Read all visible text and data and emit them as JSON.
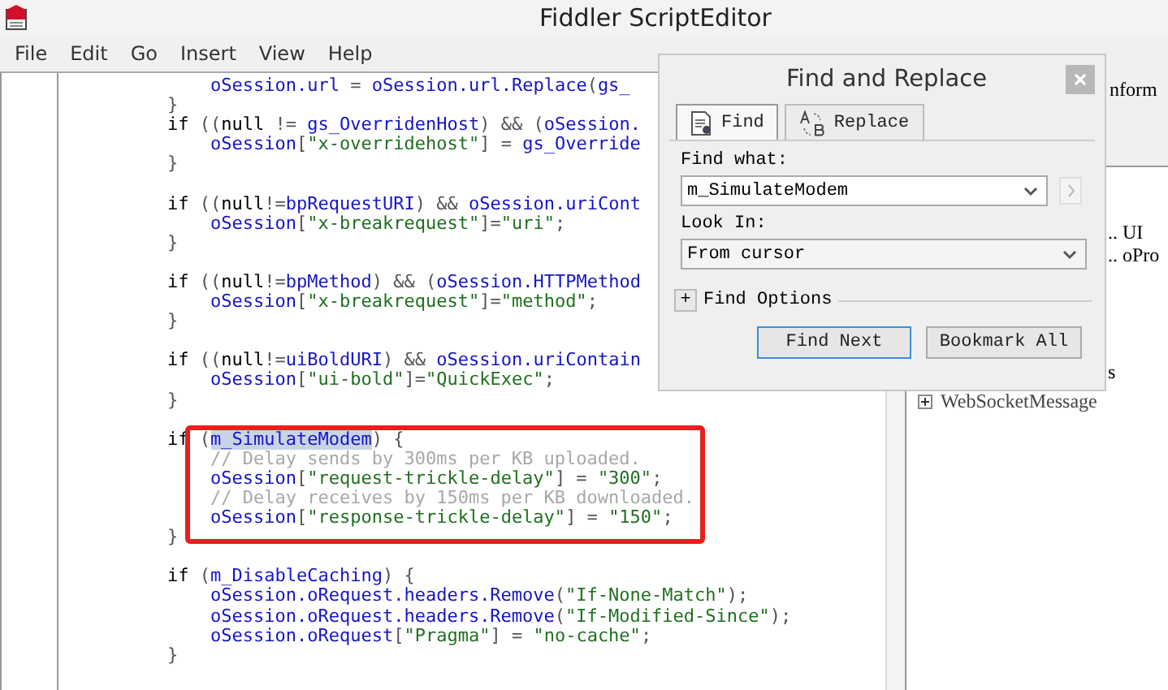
{
  "window": {
    "title": "Fiddler ScriptEditor"
  },
  "menu": [
    {
      "label": "File"
    },
    {
      "label": "Edit"
    },
    {
      "label": "Go"
    },
    {
      "label": "Insert"
    },
    {
      "label": "View"
    },
    {
      "label": "Help"
    }
  ],
  "editor": {
    "lines": [
      {
        "kind": "group",
        "children": [
          {
            "kind": "code",
            "tokens": [
              {
                "text": "oSession.url",
                "kind": "identifier"
              },
              {
                "text": " = ",
                "kind": "punct"
              },
              {
                "text": "oSession.url.Replace",
                "kind": "identifier"
              },
              {
                "text": "(",
                "kind": "punct"
              },
              {
                "text": "gs_",
                "kind": "identifier"
              }
            ]
          }
        ]
      },
      {
        "kind": "code",
        "tokens": [
          {
            "text": "}",
            "kind": "punct"
          }
        ]
      },
      {
        "kind": "code",
        "tokens": [
          {
            "text": "if",
            "kind": "keyword"
          },
          {
            "text": " ((",
            "kind": "punct"
          },
          {
            "text": "null",
            "kind": "keyword"
          },
          {
            "text": " != ",
            "kind": "punct"
          },
          {
            "text": "gs_OverridenHost",
            "kind": "identifier"
          },
          {
            "text": ") && (",
            "kind": "punct"
          },
          {
            "text": "oSession.",
            "kind": "identifier"
          }
        ],
        "children": [
          {
            "kind": "code",
            "tokens": [
              {
                "text": "oSession",
                "kind": "identifier"
              },
              {
                "text": "[",
                "kind": "punct"
              },
              {
                "text": "\"x-overridehost\"",
                "kind": "string"
              },
              {
                "text": "] = ",
                "kind": "punct"
              },
              {
                "text": "gs_Override",
                "kind": "identifier"
              }
            ]
          }
        ]
      },
      {
        "kind": "code",
        "tokens": [
          {
            "text": "}",
            "kind": "punct"
          }
        ]
      },
      {
        "kind": "blank"
      },
      {
        "kind": "code",
        "tokens": [
          {
            "text": "if",
            "kind": "keyword"
          },
          {
            "text": " ((",
            "kind": "punct"
          },
          {
            "text": "null",
            "kind": "keyword"
          },
          {
            "text": "!=",
            "kind": "punct"
          },
          {
            "text": "bpRequestURI",
            "kind": "identifier"
          },
          {
            "text": ") && ",
            "kind": "punct"
          },
          {
            "text": "oSession.uriCont",
            "kind": "identifier"
          }
        ],
        "children": [
          {
            "kind": "code",
            "tokens": [
              {
                "text": "oSession",
                "kind": "identifier"
              },
              {
                "text": "[",
                "kind": "punct"
              },
              {
                "text": "\"x-breakrequest\"",
                "kind": "string"
              },
              {
                "text": "]=",
                "kind": "punct"
              },
              {
                "text": "\"uri\"",
                "kind": "string"
              },
              {
                "text": ";",
                "kind": "punct"
              }
            ]
          }
        ]
      },
      {
        "kind": "code",
        "tokens": [
          {
            "text": "}",
            "kind": "punct"
          }
        ]
      },
      {
        "kind": "blank"
      },
      {
        "kind": "code",
        "tokens": [
          {
            "text": "if",
            "kind": "keyword"
          },
          {
            "text": " ((",
            "kind": "punct"
          },
          {
            "text": "null",
            "kind": "keyword"
          },
          {
            "text": "!=",
            "kind": "punct"
          },
          {
            "text": "bpMethod",
            "kind": "identifier"
          },
          {
            "text": ") && (",
            "kind": "punct"
          },
          {
            "text": "oSession.HTTPMethod",
            "kind": "identifier"
          }
        ],
        "children": [
          {
            "kind": "code",
            "tokens": [
              {
                "text": "oSession",
                "kind": "identifier"
              },
              {
                "text": "[",
                "kind": "punct"
              },
              {
                "text": "\"x-breakrequest\"",
                "kind": "string"
              },
              {
                "text": "]=",
                "kind": "punct"
              },
              {
                "text": "\"method\"",
                "kind": "string"
              },
              {
                "text": ";",
                "kind": "punct"
              }
            ]
          }
        ]
      },
      {
        "kind": "code",
        "tokens": [
          {
            "text": "}",
            "kind": "punct"
          }
        ]
      },
      {
        "kind": "blank"
      },
      {
        "kind": "code",
        "tokens": [
          {
            "text": "if",
            "kind": "keyword"
          },
          {
            "text": " ((",
            "kind": "punct"
          },
          {
            "text": "null",
            "kind": "keyword"
          },
          {
            "text": "!=",
            "kind": "punct"
          },
          {
            "text": "uiBoldURI",
            "kind": "identifier"
          },
          {
            "text": ") && ",
            "kind": "punct"
          },
          {
            "text": "oSession.uriContain",
            "kind": "identifier"
          }
        ],
        "children": [
          {
            "kind": "code",
            "tokens": [
              {
                "text": "oSession",
                "kind": "identifier"
              },
              {
                "text": "[",
                "kind": "punct"
              },
              {
                "text": "\"ui-bold\"",
                "kind": "string"
              },
              {
                "text": "]=",
                "kind": "punct"
              },
              {
                "text": "\"QuickExec\"",
                "kind": "string"
              },
              {
                "text": ";",
                "kind": "punct"
              }
            ]
          }
        ]
      },
      {
        "kind": "code",
        "tokens": [
          {
            "text": "}",
            "kind": "punct"
          }
        ]
      },
      {
        "kind": "blank"
      },
      {
        "kind": "code",
        "tokens": [
          {
            "text": "if",
            "kind": "keyword"
          },
          {
            "text": " (",
            "kind": "punct"
          },
          {
            "text": "m_SimulateModem",
            "kind": "selection"
          },
          {
            "text": ") {",
            "kind": "punct"
          }
        ],
        "children": [
          {
            "kind": "code",
            "tokens": [
              {
                "text": "// Delay sends by 300ms per KB uploaded.",
                "kind": "comment"
              }
            ]
          },
          {
            "kind": "code",
            "tokens": [
              {
                "text": "oSession",
                "kind": "identifier"
              },
              {
                "text": "[",
                "kind": "punct"
              },
              {
                "text": "\"request-trickle-delay\"",
                "kind": "string"
              },
              {
                "text": "] = ",
                "kind": "punct"
              },
              {
                "text": "\"300\"",
                "kind": "string"
              },
              {
                "text": ";",
                "kind": "punct"
              }
            ]
          },
          {
            "kind": "code",
            "tokens": [
              {
                "text": "// Delay receives by 150ms per KB downloaded.",
                "kind": "comment"
              }
            ]
          },
          {
            "kind": "code",
            "tokens": [
              {
                "text": "oSession",
                "kind": "identifier"
              },
              {
                "text": "[",
                "kind": "punct"
              },
              {
                "text": "\"response-trickle-delay\"",
                "kind": "string"
              },
              {
                "text": "] = ",
                "kind": "punct"
              },
              {
                "text": "\"150\"",
                "kind": "string"
              },
              {
                "text": ";",
                "kind": "punct"
              }
            ]
          }
        ]
      },
      {
        "kind": "code",
        "tokens": [
          {
            "text": "}",
            "kind": "punct"
          }
        ]
      },
      {
        "kind": "blank"
      },
      {
        "kind": "code",
        "tokens": [
          {
            "text": "if",
            "kind": "keyword"
          },
          {
            "text": " (",
            "kind": "punct"
          },
          {
            "text": "m_DisableCaching",
            "kind": "identifier"
          },
          {
            "text": ") {",
            "kind": "punct"
          }
        ],
        "children": [
          {
            "kind": "code",
            "tokens": [
              {
                "text": "oSession.oRequest.headers.Remove",
                "kind": "identifier"
              },
              {
                "text": "(",
                "kind": "punct"
              },
              {
                "text": "\"If-None-Match\"",
                "kind": "string"
              },
              {
                "text": ");",
                "kind": "punct"
              }
            ]
          },
          {
            "kind": "code",
            "tokens": [
              {
                "text": "oSession.oRequest.headers.Remove",
                "kind": "identifier"
              },
              {
                "text": "(",
                "kind": "punct"
              },
              {
                "text": "\"If-Modified-Since\"",
                "kind": "string"
              },
              {
                "text": ");",
                "kind": "punct"
              }
            ]
          },
          {
            "kind": "code",
            "tokens": [
              {
                "text": "oSession.oRequest",
                "kind": "identifier"
              },
              {
                "text": "[",
                "kind": "punct"
              },
              {
                "text": "\"Pragma\"",
                "kind": "string"
              },
              {
                "text": "] = ",
                "kind": "punct"
              },
              {
                "text": "\"no-cache\"",
                "kind": "string"
              },
              {
                "text": ";",
                "kind": "punct"
              }
            ]
          }
        ]
      },
      {
        "kind": "code",
        "tokens": [
          {
            "text": "}",
            "kind": "punct"
          }
        ]
      }
    ]
  },
  "side_panel": {
    "header_text": "nform",
    "item_groups": [
      [
        {
          "label": ".. UI",
          "kind": "leaf"
        },
        {
          "label": ".. oPro",
          "kind": "leaf"
        }
      ],
      [
        {
          "label": "s",
          "kind": "leaf"
        },
        {
          "label": "WebSocketMessage",
          "kind": "node"
        }
      ]
    ]
  },
  "dialog": {
    "title": "Find and Replace",
    "tabs": [
      {
        "label": "Find",
        "selected": true
      },
      {
        "label": "Replace",
        "selected": false
      }
    ],
    "find_what": {
      "label": "Find what:",
      "value": "m_SimulateModem"
    },
    "look_in": {
      "label": "Look In:",
      "value": "From cursor"
    },
    "options": {
      "toggle": "+",
      "label": "Find Options"
    },
    "buttons": [
      {
        "label": "Find Next",
        "focused": true
      },
      {
        "label": "Bookmark All",
        "focused": false
      }
    ]
  }
}
